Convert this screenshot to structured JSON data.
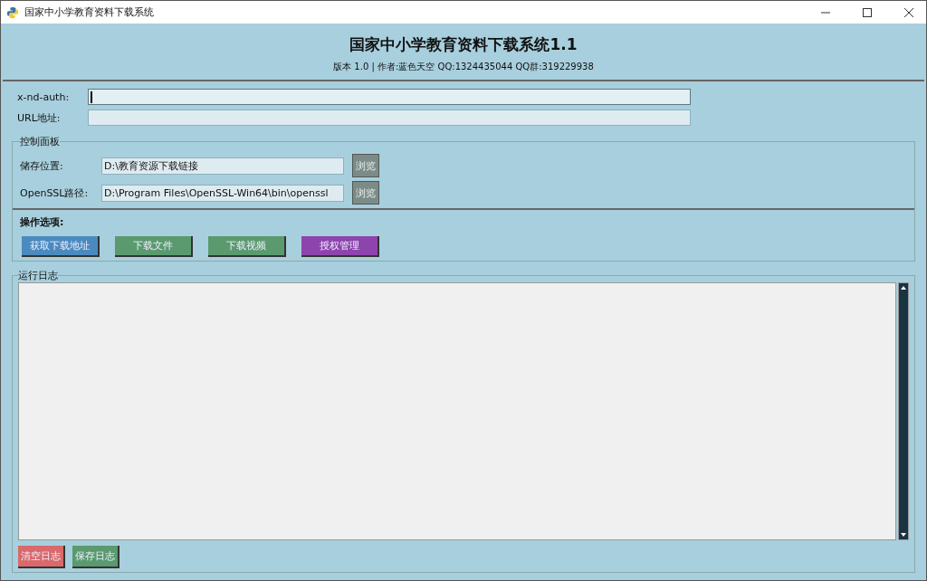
{
  "window": {
    "title": "国家中小学教育资料下载系统"
  },
  "header": {
    "title": "国家中小学教育资料下载系统1.1",
    "subtitle": "版本 1.0 | 作者:蓝色天空 QQ:1324435044 QQ群:319229938"
  },
  "fields": [
    {
      "label": "x-nd-auth:",
      "focused": true
    },
    {
      "label": "URL地址:",
      "focused": false
    }
  ],
  "control_panel": {
    "title": "控制面板",
    "paths": [
      {
        "label": "储存位置:",
        "value": "D:\\教育资源下载链接",
        "button": "浏览"
      },
      {
        "label": "OpenSSL路径:",
        "value": "D:\\Program Files\\OpenSSL-Win64\\bin\\openssl",
        "button": "浏览"
      }
    ],
    "options_label": "操作选项:",
    "actions": [
      {
        "label": "获取下载地址",
        "color": "#4a8abf"
      },
      {
        "label": "下载文件",
        "color": "#5a9a6e"
      },
      {
        "label": "下载视频",
        "color": "#5a9a6e"
      },
      {
        "label": "授权管理",
        "color": "#8e44ad"
      }
    ]
  },
  "log": {
    "title": "运行日志",
    "buttons": [
      {
        "label": "清空日志",
        "color": "#d9696a"
      },
      {
        "label": "保存日志",
        "color": "#5a9a6e"
      }
    ]
  }
}
